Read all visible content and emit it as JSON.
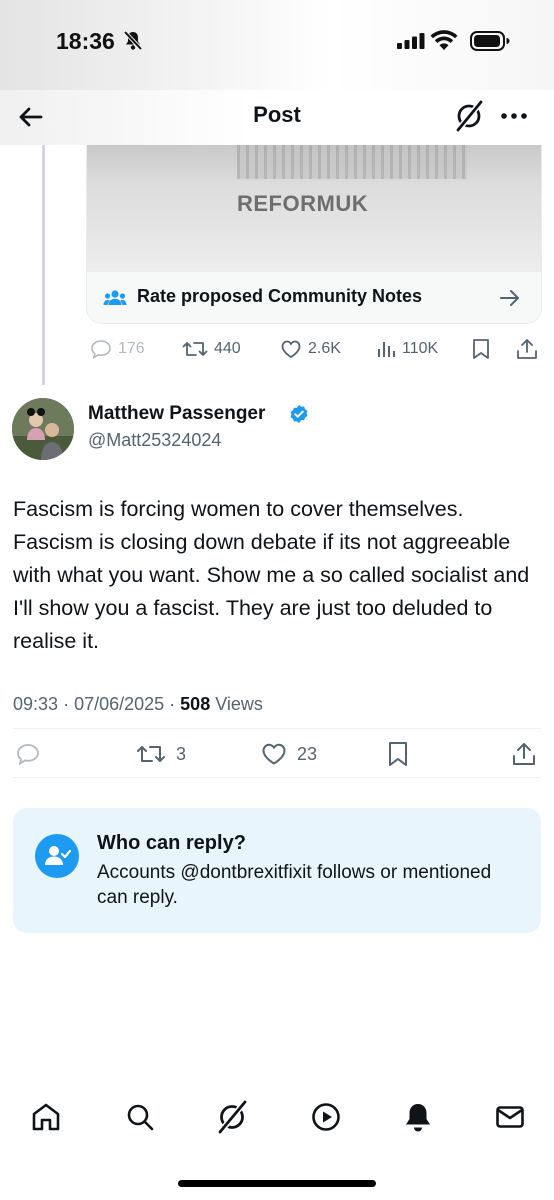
{
  "status_bar": {
    "time": "18:36",
    "icons": [
      "bell-slash-icon",
      "signal-icon",
      "wifi-icon",
      "battery-icon"
    ]
  },
  "header": {
    "title": "Post",
    "icons": [
      "back-arrow-icon",
      "grok-icon",
      "more-icon"
    ]
  },
  "quoted_post": {
    "media_logo_text": "REFORMUK",
    "community_notes_label": "Rate proposed Community Notes",
    "actions": {
      "replies": "176",
      "reposts": "440",
      "likes": "2.6K",
      "views": "110K"
    }
  },
  "post": {
    "author_name": "Matthew Passenger",
    "author_handle": "@Matt25324024",
    "verified_color": "#1d9bf0",
    "body": "Fascism is forcing women to cover themselves. Fascism is closing down debate if its not aggreeable with what you want. Show me a so called socialist and I'll show you a fascist. They are just too deluded to realise it.",
    "time": "09:33",
    "date": "07/06/2025",
    "views_count": "508",
    "views_label": "Views",
    "actions": {
      "reposts": "3",
      "likes": "23"
    }
  },
  "reply_restriction": {
    "title": "Who can reply?",
    "text": "Accounts @dontbrexitfixit follows or mentioned can reply."
  },
  "tab_bar": {
    "items": [
      "home-icon",
      "search-icon",
      "grok-icon",
      "video-icon",
      "notifications-icon",
      "messages-icon"
    ]
  },
  "colors": {
    "accent": "#1d9bf0",
    "text_secondary": "#536471",
    "reply_box_bg": "#e8f5fd"
  }
}
